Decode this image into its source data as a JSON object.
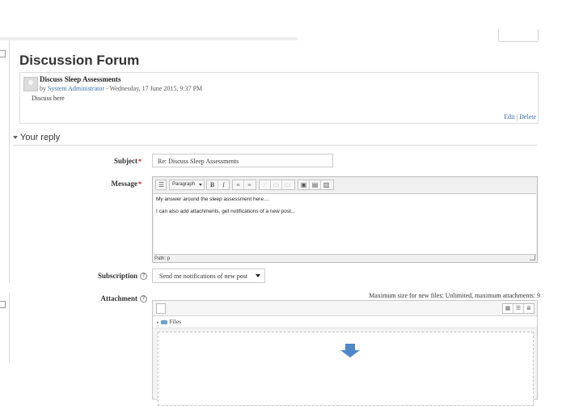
{
  "page": {
    "title": "Discussion Forum"
  },
  "post": {
    "subject": "Discuss Sleep Assessments",
    "by_prefix": "by",
    "author": "System Administrator",
    "date": "- Wednesday, 17 June 2015, 9:37 PM",
    "body": "Discuss here",
    "edit_label": "Edit",
    "separator": "|",
    "delete_label": "Delete"
  },
  "reply": {
    "section_title": "Your reply",
    "subject_label": "Subject",
    "subject_value": "Re: Discuss Sleep Assessments",
    "message_label": "Message",
    "message_lines": [
      "My answer around the sleep assessment here....",
      "I can also add attachments, get notifications of a new post..."
    ],
    "editor": {
      "format_select": "Paragraph",
      "bold": "B",
      "italic": "I",
      "path_label": "Path: p"
    },
    "subscription_label": "Subscription",
    "subscription_value": "Send me notifications of new post",
    "attachment_label": "Attachment",
    "max_size_text": "Maximum size for new files: Unlimited, maximum attachments: 9",
    "files_label": "Files",
    "help_icon": "?"
  },
  "colors": {
    "link": "#3a6fb0",
    "required": "#cc0000",
    "drop_arrow": "#4d87cc"
  }
}
